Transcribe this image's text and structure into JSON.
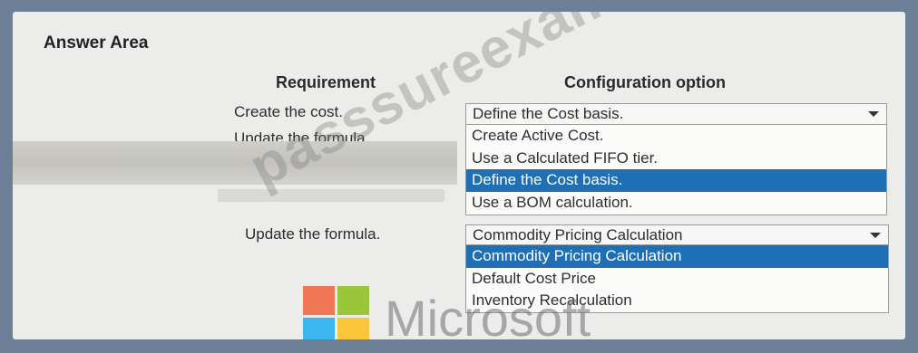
{
  "answer_area": {
    "title": "Answer Area"
  },
  "headers": {
    "requirement": "Requirement",
    "configuration": "Configuration option"
  },
  "requirements": [
    "Create the cost.",
    "Update the formula.",
    "Update the formula."
  ],
  "dropdown1": {
    "selected": "Define the Cost basis.",
    "options": [
      "Create Active Cost.",
      "Use a Calculated FIFO tier.",
      "Define the Cost basis.",
      "Use a BOM calculation."
    ],
    "highlighted_index": 2
  },
  "dropdown2": {
    "selected": "Commodity Pricing Calculation",
    "options": [
      "Commodity Pricing Calculation",
      "Default Cost Price",
      "Inventory Recalculation"
    ],
    "highlighted_index": 0
  },
  "watermark": {
    "text": "passsureexam.com",
    "brand": "Microsoft"
  },
  "colors": {
    "highlight": "#1f6fb4",
    "ms_red": "#f25022",
    "ms_green": "#7fba00",
    "ms_blue": "#00a4ef",
    "ms_yellow": "#ffb900"
  }
}
